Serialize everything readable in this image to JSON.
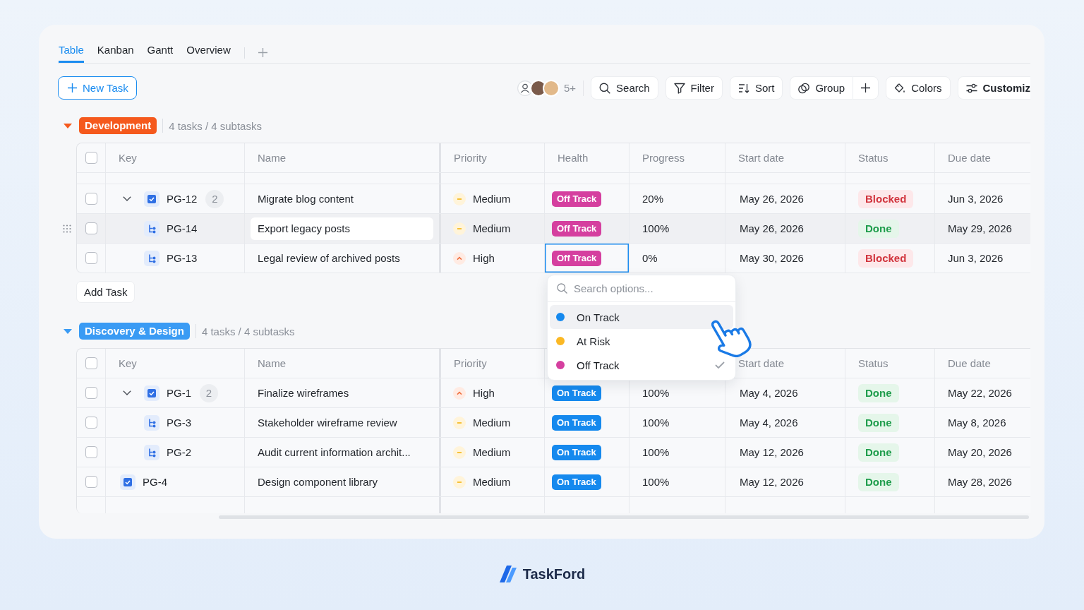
{
  "tabs": [
    {
      "label": "Table",
      "selected": true
    },
    {
      "label": "Kanban",
      "selected": false
    },
    {
      "label": "Gantt",
      "selected": false
    },
    {
      "label": "Overview",
      "selected": false
    }
  ],
  "toolbar": {
    "new_task": "New Task",
    "members_more": "5+",
    "buttons": [
      {
        "kind": "search",
        "label": "Search"
      },
      {
        "kind": "filter",
        "label": "Filter"
      },
      {
        "kind": "sort",
        "label": "Sort"
      },
      {
        "kind": "group",
        "label": "Group"
      },
      {
        "kind": "add"
      },
      {
        "kind": "colors",
        "label": "Colors"
      },
      {
        "kind": "customize",
        "label": "Customiz"
      }
    ]
  },
  "groups": [
    {
      "name": "Development",
      "color": "#f5591d",
      "expanded": true,
      "summary": "4 tasks / 4 subtasks",
      "all_checked": false,
      "columns": [
        "Key",
        "Name",
        "Priority",
        "Health",
        "Progress",
        "Start date",
        "Status",
        "Due date"
      ],
      "rows": [
        {
          "key": "PG-12",
          "subtask_count": "2",
          "expanded": true,
          "checked": false,
          "hovered": false,
          "name": "Migrate blog content",
          "priority": {
            "kind": "medium",
            "label": "Medium"
          },
          "health": {
            "label": "Off Track",
            "color": "#d53f9f",
            "selected": false
          },
          "progress": "20%",
          "start_date": "May 26, 2026",
          "status": {
            "kind": "blocked",
            "label": "Blocked"
          },
          "due_date": "Jun 3, 2026",
          "children": [
            {
              "key": "PG-14",
              "checked": false,
              "hovered": true,
              "name": "Export legacy posts",
              "priority": {
                "kind": "medium",
                "label": "Medium"
              },
              "health": {
                "label": "Off Track",
                "color": "#d53f9f",
                "selected": false
              },
              "progress": "100%",
              "start_date": "May 26, 2026",
              "status": {
                "kind": "done",
                "label": "Done"
              },
              "due_date": "May 29, 2026"
            },
            {
              "key": "PG-13",
              "checked": false,
              "hovered": false,
              "name": "Legal review of archived posts",
              "priority": {
                "kind": "high",
                "label": "High"
              },
              "health": {
                "label": "Off Track",
                "color": "#d53f9f",
                "selected": true
              },
              "progress": "0%",
              "start_date": "May 30, 2026",
              "status": {
                "kind": "blocked",
                "label": "Blocked"
              },
              "due_date": "Jun 3, 2026"
            }
          ]
        }
      ],
      "add_task": "Add Task"
    },
    {
      "name": "Discovery & Design",
      "color": "#3a9bf4",
      "expanded": true,
      "summary": "4 tasks / 4 subtasks",
      "all_checked": false,
      "columns": [
        "Key",
        "Name",
        "Priority",
        null,
        null,
        "Start date",
        "Status",
        "Due date"
      ],
      "rows": [
        {
          "key": "PG-1",
          "subtask_count": "2",
          "expanded": true,
          "checked": false,
          "hovered": false,
          "name": "Finalize wireframes",
          "priority": {
            "kind": "high",
            "label": "High"
          },
          "health": {
            "label": "On Track",
            "color": "#1589ee",
            "selected": false
          },
          "progress": "100%",
          "start_date": "May 4, 2026",
          "status": {
            "kind": "done",
            "label": "Done"
          },
          "due_date": "May 22, 2026",
          "children": [
            {
              "key": "PG-3",
              "checked": false,
              "hovered": false,
              "name": "Stakeholder wireframe review",
              "priority": {
                "kind": "medium",
                "label": "Medium"
              },
              "health": {
                "label": "On Track",
                "color": "#1589ee",
                "selected": false
              },
              "progress": "100%",
              "start_date": "May 4, 2026",
              "status": {
                "kind": "done",
                "label": "Done"
              },
              "due_date": "May 8, 2026"
            },
            {
              "key": "PG-2",
              "checked": false,
              "hovered": false,
              "name": "Audit current information archit...",
              "priority": {
                "kind": "medium",
                "label": "Medium"
              },
              "health": {
                "label": "On Track",
                "color": "#1589ee",
                "selected": false
              },
              "progress": "100%",
              "start_date": "May 12, 2026",
              "status": {
                "kind": "done",
                "label": "Done"
              },
              "due_date": "May 20, 2026"
            }
          ]
        },
        {
          "key": "PG-4",
          "checked": false,
          "hovered": false,
          "name": "Design component library",
          "priority": {
            "kind": "medium",
            "label": "Medium"
          },
          "health": {
            "label": "On Track",
            "color": "#1589ee",
            "selected": false
          },
          "progress": "100%",
          "start_date": "May 12, 2026",
          "status": {
            "kind": "done",
            "label": "Done"
          },
          "due_date": "May 28, 2026"
        }
      ]
    }
  ],
  "health_menu": {
    "placeholder": "Search options...",
    "options": [
      {
        "label": "On Track",
        "color": "#1589ee",
        "highlighted": true,
        "selected": false
      },
      {
        "label": "At Risk",
        "color": "#fbb824",
        "highlighted": false,
        "selected": false
      },
      {
        "label": "Off Track",
        "color": "#d53f9f",
        "highlighted": false,
        "selected": true
      }
    ]
  },
  "footer": {
    "brand": "TaskFord"
  }
}
